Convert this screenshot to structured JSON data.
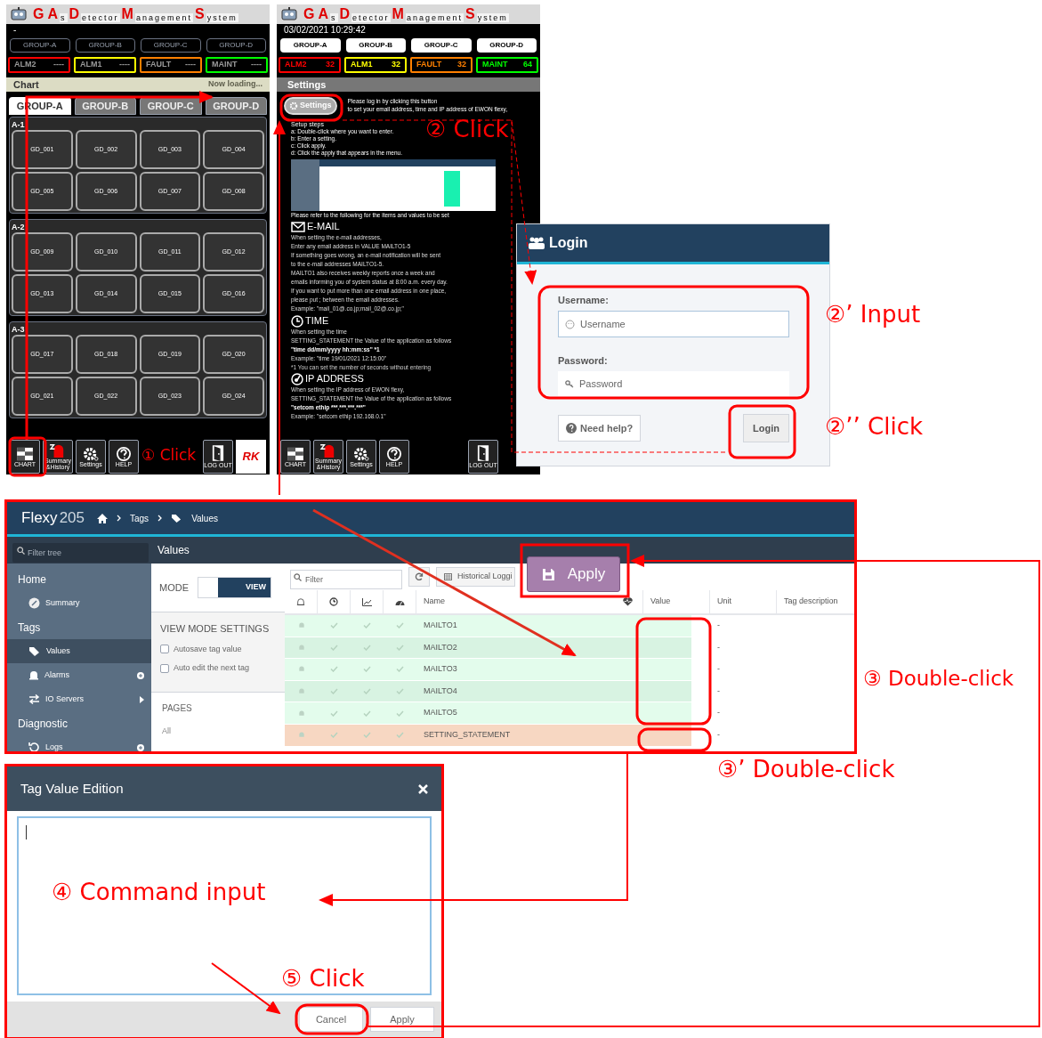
{
  "chart_screen": {
    "title": [
      {
        "text": "G",
        "kind": "big"
      },
      {
        "text": "A",
        "kind": "big"
      },
      {
        "text": "s",
        "kind": "small"
      },
      {
        "text": "D",
        "kind": "big"
      },
      {
        "text": "etector",
        "kind": "small"
      },
      {
        "text": "M",
        "kind": "big"
      },
      {
        "text": "anagement",
        "kind": "small"
      },
      {
        "text": "S",
        "kind": "big"
      },
      {
        "text": "ystem",
        "kind": "small"
      }
    ],
    "datetime": "-",
    "groups": [
      "GROUP-A",
      "GROUP-B",
      "GROUP-C",
      "GROUP-D"
    ],
    "statuses": [
      {
        "label": "ALM2",
        "count": "----",
        "color": "#ff0000"
      },
      {
        "label": "ALM1",
        "count": "----",
        "color": "#ffff00"
      },
      {
        "label": "FAULT",
        "count": "----",
        "color": "#ff8000"
      },
      {
        "label": "MAINT",
        "count": "----",
        "color": "#00ff00"
      }
    ],
    "section_title": "Chart",
    "loading": "Now loading...",
    "tabs": [
      {
        "label": "GROUP-A",
        "selected": true
      },
      {
        "label": "GROUP-B",
        "selected": false
      },
      {
        "label": "GROUP-C",
        "selected": false
      },
      {
        "label": "GROUP-D",
        "selected": false
      }
    ],
    "areas": [
      {
        "label": "A-1",
        "detectors": [
          "GD_001",
          "GD_002",
          "GD_003",
          "GD_004",
          "GD_005",
          "GD_006",
          "GD_007",
          "GD_008"
        ]
      },
      {
        "label": "A-2",
        "detectors": [
          "GD_009",
          "GD_010",
          "GD_011",
          "GD_012",
          "GD_013",
          "GD_014",
          "GD_015",
          "GD_016"
        ]
      },
      {
        "label": "A-3",
        "detectors": [
          "GD_017",
          "GD_018",
          "GD_019",
          "GD_020",
          "GD_021",
          "GD_022",
          "GD_023",
          "GD_024"
        ]
      }
    ],
    "toolbar": [
      "CHART",
      "Summary &History",
      "Settings",
      "HELP"
    ],
    "logout": "LOG OUT",
    "logo": "RK"
  },
  "settings_screen": {
    "title": [
      {
        "text": "G",
        "kind": "big"
      },
      {
        "text": "A",
        "kind": "big"
      },
      {
        "text": "s",
        "kind": "small"
      },
      {
        "text": "D",
        "kind": "big"
      },
      {
        "text": "etector",
        "kind": "small"
      },
      {
        "text": "M",
        "kind": "big"
      },
      {
        "text": "anagement",
        "kind": "small"
      },
      {
        "text": "S",
        "kind": "big"
      },
      {
        "text": "ystem",
        "kind": "small"
      }
    ],
    "datetime": "03/02/2021 10:29:42",
    "groups": [
      "GROUP-A",
      "GROUP-B",
      "GROUP-C",
      "GROUP-D"
    ],
    "statuses": [
      {
        "label": "ALM2",
        "count": "32",
        "color": "#ff0000"
      },
      {
        "label": "ALM1",
        "count": "32",
        "color": "#ffff00"
      },
      {
        "label": "FAULT",
        "count": "32",
        "color": "#ff8000"
      },
      {
        "label": "MAINT",
        "count": "64",
        "color": "#00ff00"
      }
    ],
    "section_title": "Settings",
    "settings_button": "Settings",
    "intro": [
      "Please log in by clicking this button",
      "to set your email address, time and IP address of EWON flexy,"
    ],
    "setup_steps": [
      "Setup steps",
      "a: Double-click where you want to enter.",
      "b: Enter a setting.",
      "c: Click apply.",
      "d: Click the apply that appears in the menu."
    ],
    "refer": "Please refer to the following for the items and values to be set",
    "sections": [
      {
        "heading": "E-MAIL",
        "lines": [
          {
            "text": "When setting the e-mail addresses,",
            "kind": "text"
          },
          {
            "text": "Enter any email address in VALUE MAILTO1-5",
            "kind": "text"
          },
          {
            "text": "If something goes wrong, an e-mail notification will be sent",
            "kind": "text"
          },
          {
            "text": "to the e-mail addresses MAILTO1-5.",
            "kind": "text"
          },
          {
            "text": "MAILTO1 also receives weekly reports once a week and",
            "kind": "text"
          },
          {
            "text": "emails informing you of system status at 8:00 a.m. every day.",
            "kind": "text"
          },
          {
            "text": "If you want to put more than one email address in one place,",
            "kind": "text"
          },
          {
            "text": "please put ; between the email addresses.",
            "kind": "text"
          },
          {
            "text": "Example: \"mail_01@.co.jp;mail_02@.co.jp;\"",
            "kind": "text"
          }
        ]
      },
      {
        "heading": "TIME",
        "lines": [
          {
            "text": "When setting the time",
            "kind": "text"
          },
          {
            "text": "SETTING_STATEMENT the Value of the application as follows",
            "kind": "text"
          },
          {
            "text": "\"time dd/mm/yyyy hh:mm:ss\" *1",
            "kind": "bold"
          },
          {
            "text": "Example: \"time 19/01/2021 12:15:00\"",
            "kind": "text"
          },
          {
            "text": "*1 You can set the number of seconds without entering",
            "kind": "note"
          }
        ]
      },
      {
        "heading": "IP ADDRESS",
        "lines": [
          {
            "text": "When setting the IP address of EWON flexy,",
            "kind": "text"
          },
          {
            "text": "SETTING_STATEMENT the Value of the application as follows",
            "kind": "text"
          },
          {
            "text": "\"setcom ethip ***.***.***.***\"",
            "kind": "bold"
          },
          {
            "text": "Example: \"setcom ethip 192.168.0.1\"",
            "kind": "text"
          }
        ]
      }
    ],
    "toolbar": [
      "CHART",
      "Summary &History",
      "Settings",
      "HELP"
    ],
    "logout": "LOG OUT"
  },
  "login": {
    "title": "Login",
    "username_label": "Username:",
    "username_placeholder": "Username",
    "password_label": "Password:",
    "password_placeholder": "Password",
    "help": "Need help?",
    "button": "Login"
  },
  "flexy": {
    "brand": "Flexy",
    "model": "205",
    "breadcrumb": [
      "Tags",
      "Values"
    ],
    "tree_filter_placeholder": "Filter tree",
    "page_title": "Values",
    "sidebar": [
      {
        "label": "Home",
        "children": [
          {
            "label": "Summary",
            "selected": false
          }
        ]
      },
      {
        "label": "Tags",
        "children": [
          {
            "label": "Values",
            "selected": true
          },
          {
            "label": "Alarms",
            "selected": false
          },
          {
            "label": "IO Servers",
            "selected": false
          }
        ]
      },
      {
        "label": "Diagnostic",
        "children": [
          {
            "label": "Logs",
            "selected": false
          }
        ]
      }
    ],
    "mode_label": "MODE",
    "mode_value": "VIEW",
    "settings_title": "VIEW MODE SETTINGS",
    "options": [
      {
        "label": "Autosave tag value",
        "checked": false
      },
      {
        "label": "Auto edit the next tag",
        "checked": false
      }
    ],
    "pages_title": "PAGES",
    "pages": [
      "All"
    ],
    "filter_placeholder": "Filter",
    "historical": "Historical Loggi",
    "apply": "Apply",
    "columns": [
      "Name",
      "Value",
      "Unit",
      "Tag description"
    ],
    "rows": [
      {
        "name": "MAILTO1",
        "unit": "-",
        "kind": "mail"
      },
      {
        "name": "MAILTO2",
        "unit": "-",
        "kind": "mail"
      },
      {
        "name": "MAILTO3",
        "unit": "-",
        "kind": "mail"
      },
      {
        "name": "MAILTO4",
        "unit": "-",
        "kind": "mail"
      },
      {
        "name": "MAILTO5",
        "unit": "-",
        "kind": "mail"
      },
      {
        "name": "SETTING_STATEMENT",
        "unit": "-",
        "kind": "statement"
      }
    ]
  },
  "dialog": {
    "title": "Tag Value Edition",
    "buttons": [
      "Cancel",
      "Apply"
    ]
  },
  "annotations": [
    "① Click",
    "② Click",
    "②’ Input",
    "②’’ Click",
    "③  Double-click",
    "③’ Double-click",
    "④  Command input",
    "⑤  Click"
  ]
}
